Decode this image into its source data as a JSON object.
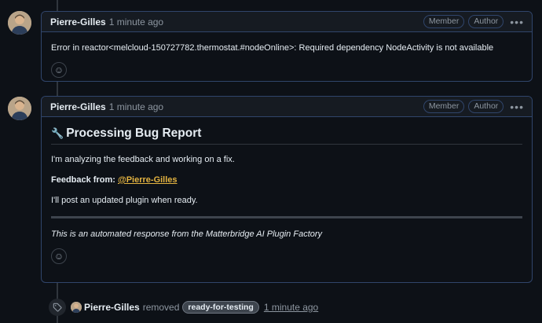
{
  "comments": [
    {
      "author": "Pierre-Gilles",
      "time": "1 minute ago",
      "badges": [
        "Member",
        "Author"
      ],
      "body": "Error in reactor<melcloud-150727782.thermostat.#nodeOnline>: Required dependency NodeActivity is not available"
    },
    {
      "author": "Pierre-Gilles",
      "time": "1 minute ago",
      "badges": [
        "Member",
        "Author"
      ],
      "title": "Processing Bug Report",
      "line1": "I'm analyzing the feedback and working on a fix.",
      "feedback_label": "Feedback from:",
      "mention": "@Pierre-Gilles",
      "line3": "I'll post an updated plugin when ready.",
      "footer": "This is an automated response from the Matterbridge AI Plugin Factory"
    }
  ],
  "event": {
    "author": "Pierre-Gilles",
    "action": "removed",
    "label": "ready-for-testing",
    "time": "1 minute ago"
  },
  "icons": {
    "more": "kebab-horizontal",
    "reaction": "smiley",
    "tag": "tag",
    "wrench": "wrench"
  },
  "colors": {
    "background": "#0d1117",
    "border": "#30456b",
    "mention": "#e3b341"
  }
}
